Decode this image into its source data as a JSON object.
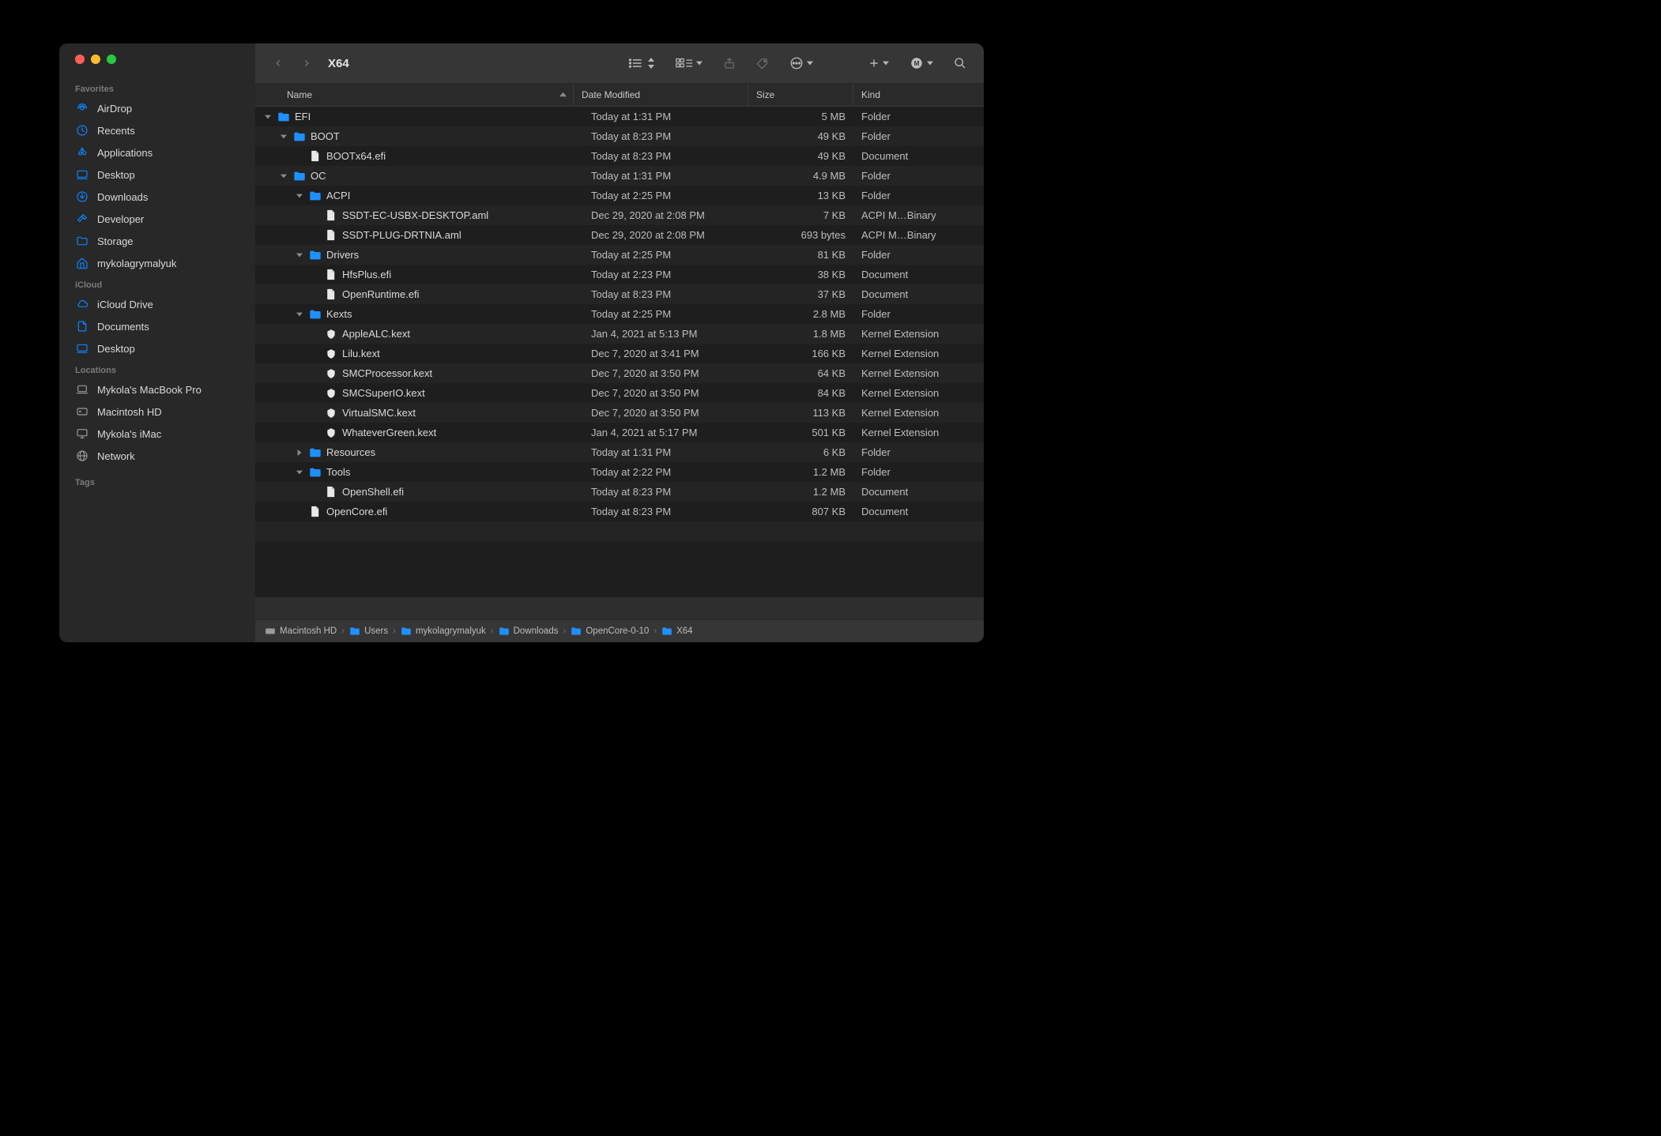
{
  "window_title": "X64",
  "sidebar": {
    "favorites_label": "Favorites",
    "favorites": [
      {
        "icon": "airdrop",
        "label": "AirDrop"
      },
      {
        "icon": "clock",
        "label": "Recents"
      },
      {
        "icon": "apps",
        "label": "Applications"
      },
      {
        "icon": "desktop",
        "label": "Desktop"
      },
      {
        "icon": "download",
        "label": "Downloads"
      },
      {
        "icon": "hammer",
        "label": "Developer"
      },
      {
        "icon": "folder",
        "label": "Storage"
      },
      {
        "icon": "home",
        "label": "mykolagrymalyuk"
      }
    ],
    "icloud_label": "iCloud",
    "icloud": [
      {
        "icon": "cloud",
        "label": "iCloud Drive"
      },
      {
        "icon": "document",
        "label": "Documents"
      },
      {
        "icon": "desktop",
        "label": "Desktop"
      }
    ],
    "locations_label": "Locations",
    "locations": [
      {
        "icon": "laptop",
        "label": "Mykola's MacBook Pro"
      },
      {
        "icon": "hdd",
        "label": "Macintosh HD"
      },
      {
        "icon": "imac",
        "label": "Mykola's iMac"
      },
      {
        "icon": "globe",
        "label": "Network"
      }
    ],
    "tags_label": "Tags"
  },
  "columns": {
    "name": "Name",
    "date": "Date Modified",
    "size": "Size",
    "kind": "Kind"
  },
  "rows": [
    {
      "depth": 0,
      "open": true,
      "icon": "folder",
      "name": "EFI",
      "date": "Today at 1:31 PM",
      "size": "5 MB",
      "kind": "Folder"
    },
    {
      "depth": 1,
      "open": true,
      "icon": "folder",
      "name": "BOOT",
      "date": "Today at 8:23 PM",
      "size": "49 KB",
      "kind": "Folder"
    },
    {
      "depth": 2,
      "icon": "file",
      "name": "BOOTx64.efi",
      "date": "Today at 8:23 PM",
      "size": "49 KB",
      "kind": "Document"
    },
    {
      "depth": 1,
      "open": true,
      "icon": "folder",
      "name": "OC",
      "date": "Today at 1:31 PM",
      "size": "4.9 MB",
      "kind": "Folder"
    },
    {
      "depth": 2,
      "open": true,
      "icon": "folder",
      "name": "ACPI",
      "date": "Today at 2:25 PM",
      "size": "13 KB",
      "kind": "Folder"
    },
    {
      "depth": 3,
      "icon": "file",
      "name": "SSDT-EC-USBX-DESKTOP.aml",
      "date": "Dec 29, 2020 at 2:08 PM",
      "size": "7 KB",
      "kind": "ACPI M…Binary"
    },
    {
      "depth": 3,
      "icon": "file",
      "name": "SSDT-PLUG-DRTNIA.aml",
      "date": "Dec 29, 2020 at 2:08 PM",
      "size": "693 bytes",
      "kind": "ACPI M…Binary"
    },
    {
      "depth": 2,
      "open": true,
      "icon": "folder",
      "name": "Drivers",
      "date": "Today at 2:25 PM",
      "size": "81 KB",
      "kind": "Folder"
    },
    {
      "depth": 3,
      "icon": "file",
      "name": "HfsPlus.efi",
      "date": "Today at 2:23 PM",
      "size": "38 KB",
      "kind": "Document"
    },
    {
      "depth": 3,
      "icon": "file",
      "name": "OpenRuntime.efi",
      "date": "Today at 8:23 PM",
      "size": "37 KB",
      "kind": "Document"
    },
    {
      "depth": 2,
      "open": true,
      "icon": "folder",
      "name": "Kexts",
      "date": "Today at 2:25 PM",
      "size": "2.8 MB",
      "kind": "Folder"
    },
    {
      "depth": 3,
      "icon": "kext",
      "name": "AppleALC.kext",
      "date": "Jan 4, 2021 at 5:13 PM",
      "size": "1.8 MB",
      "kind": "Kernel Extension"
    },
    {
      "depth": 3,
      "icon": "kext",
      "name": "Lilu.kext",
      "date": "Dec 7, 2020 at 3:41 PM",
      "size": "166 KB",
      "kind": "Kernel Extension"
    },
    {
      "depth": 3,
      "icon": "kext",
      "name": "SMCProcessor.kext",
      "date": "Dec 7, 2020 at 3:50 PM",
      "size": "64 KB",
      "kind": "Kernel Extension"
    },
    {
      "depth": 3,
      "icon": "kext",
      "name": "SMCSuperIO.kext",
      "date": "Dec 7, 2020 at 3:50 PM",
      "size": "84 KB",
      "kind": "Kernel Extension"
    },
    {
      "depth": 3,
      "icon": "kext",
      "name": "VirtualSMC.kext",
      "date": "Dec 7, 2020 at 3:50 PM",
      "size": "113 KB",
      "kind": "Kernel Extension"
    },
    {
      "depth": 3,
      "icon": "kext",
      "name": "WhateverGreen.kext",
      "date": "Jan 4, 2021 at 5:17 PM",
      "size": "501 KB",
      "kind": "Kernel Extension"
    },
    {
      "depth": 2,
      "open": false,
      "icon": "folder",
      "name": "Resources",
      "date": "Today at 1:31 PM",
      "size": "6 KB",
      "kind": "Folder"
    },
    {
      "depth": 2,
      "open": true,
      "icon": "folder",
      "name": "Tools",
      "date": "Today at 2:22 PM",
      "size": "1.2 MB",
      "kind": "Folder"
    },
    {
      "depth": 3,
      "icon": "file",
      "name": "OpenShell.efi",
      "date": "Today at 8:23 PM",
      "size": "1.2 MB",
      "kind": "Document"
    },
    {
      "depth": 2,
      "icon": "file",
      "name": "OpenCore.efi",
      "date": "Today at 8:23 PM",
      "size": "807 KB",
      "kind": "Document"
    }
  ],
  "path": [
    {
      "icon": "hdd-mini",
      "label": "Macintosh HD"
    },
    {
      "icon": "folder-mini",
      "label": "Users"
    },
    {
      "icon": "folder-mini",
      "label": "mykolagrymalyuk"
    },
    {
      "icon": "folder-mini",
      "label": "Downloads"
    },
    {
      "icon": "folder-mini",
      "label": "OpenCore-0-10"
    },
    {
      "icon": "folder-mini",
      "label": "X64"
    }
  ]
}
